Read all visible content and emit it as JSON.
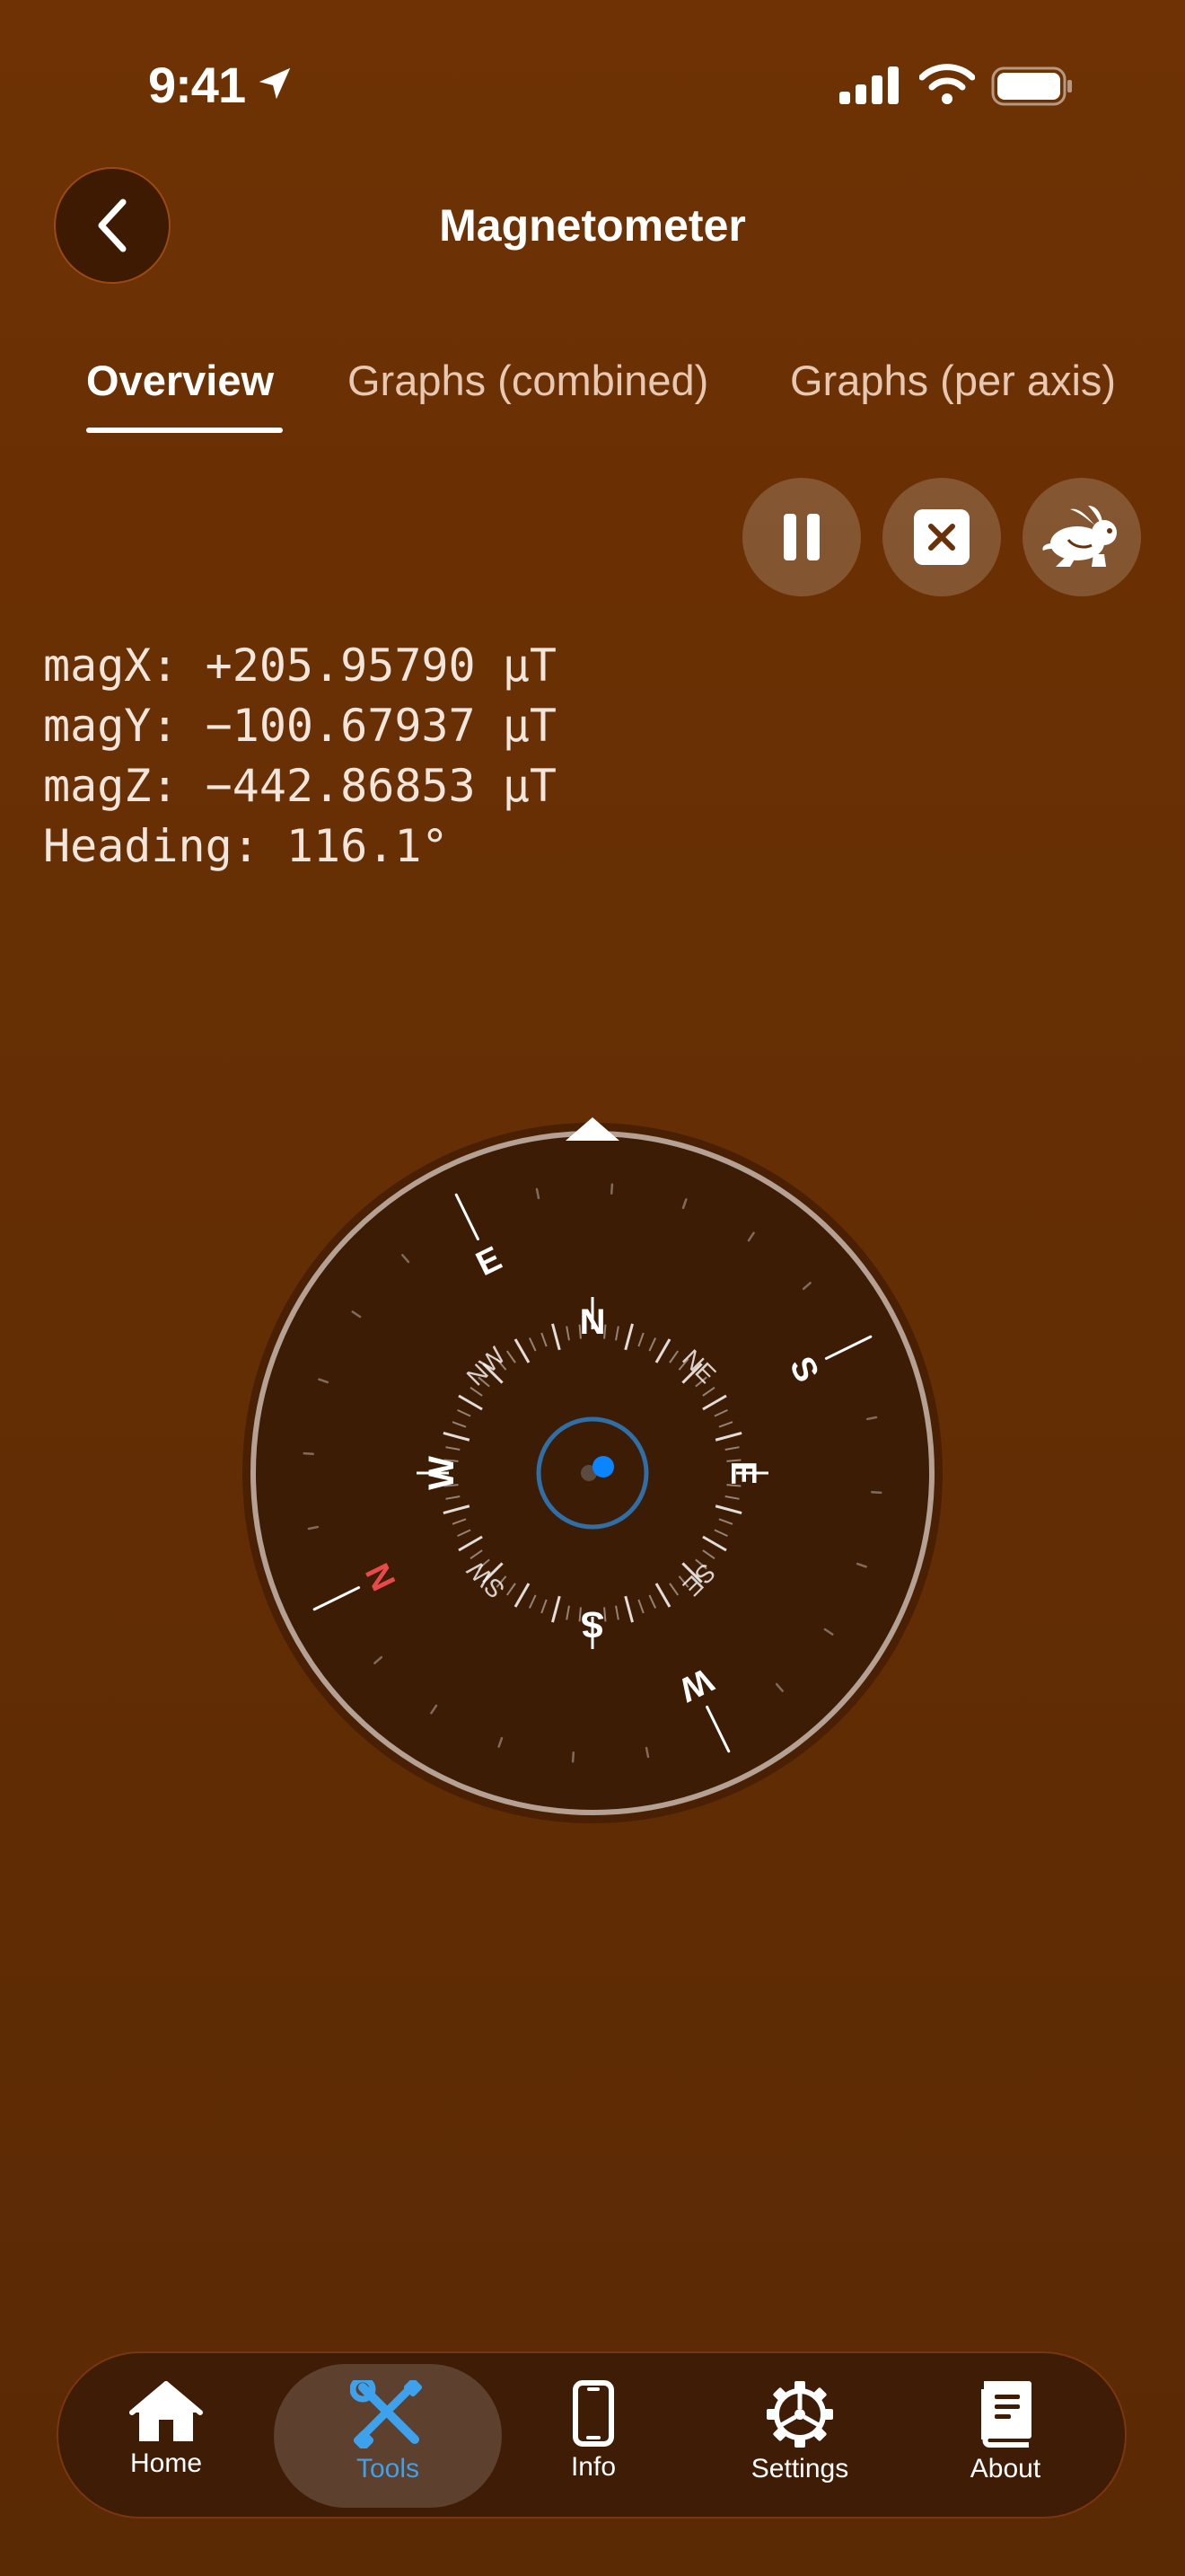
{
  "status_bar": {
    "time": "9:41"
  },
  "header": {
    "title": "Magnetometer"
  },
  "tabs": [
    {
      "label": "Overview"
    },
    {
      "label": "Graphs (combined)"
    },
    {
      "label": "Graphs (per axis)"
    }
  ],
  "readouts": {
    "mag_x": "magX: +205.95790 µT",
    "mag_y": "magY: −100.67937 µT",
    "mag_z": "magZ: −442.86853 µT",
    "heading": "Heading: 116.1°"
  },
  "compass": {
    "heading_deg": 116.1,
    "outer_labels": {
      "north": "N",
      "east": "E",
      "south": "S",
      "west": "W"
    },
    "inner_cardinals": {
      "north": "N",
      "east": "E",
      "south": "S",
      "west": "W"
    },
    "inner_intercardinals": {
      "ne": "NE",
      "se": "SE",
      "sw": "SW",
      "nw": "NW"
    },
    "north_color": "#e84a4a",
    "bubble_color": "#0a84ff"
  },
  "tab_bar": {
    "items": [
      {
        "label": "Home"
      },
      {
        "label": "Tools"
      },
      {
        "label": "Info"
      },
      {
        "label": "Settings"
      },
      {
        "label": "About"
      }
    ],
    "active_color": "#3ea1ec"
  }
}
